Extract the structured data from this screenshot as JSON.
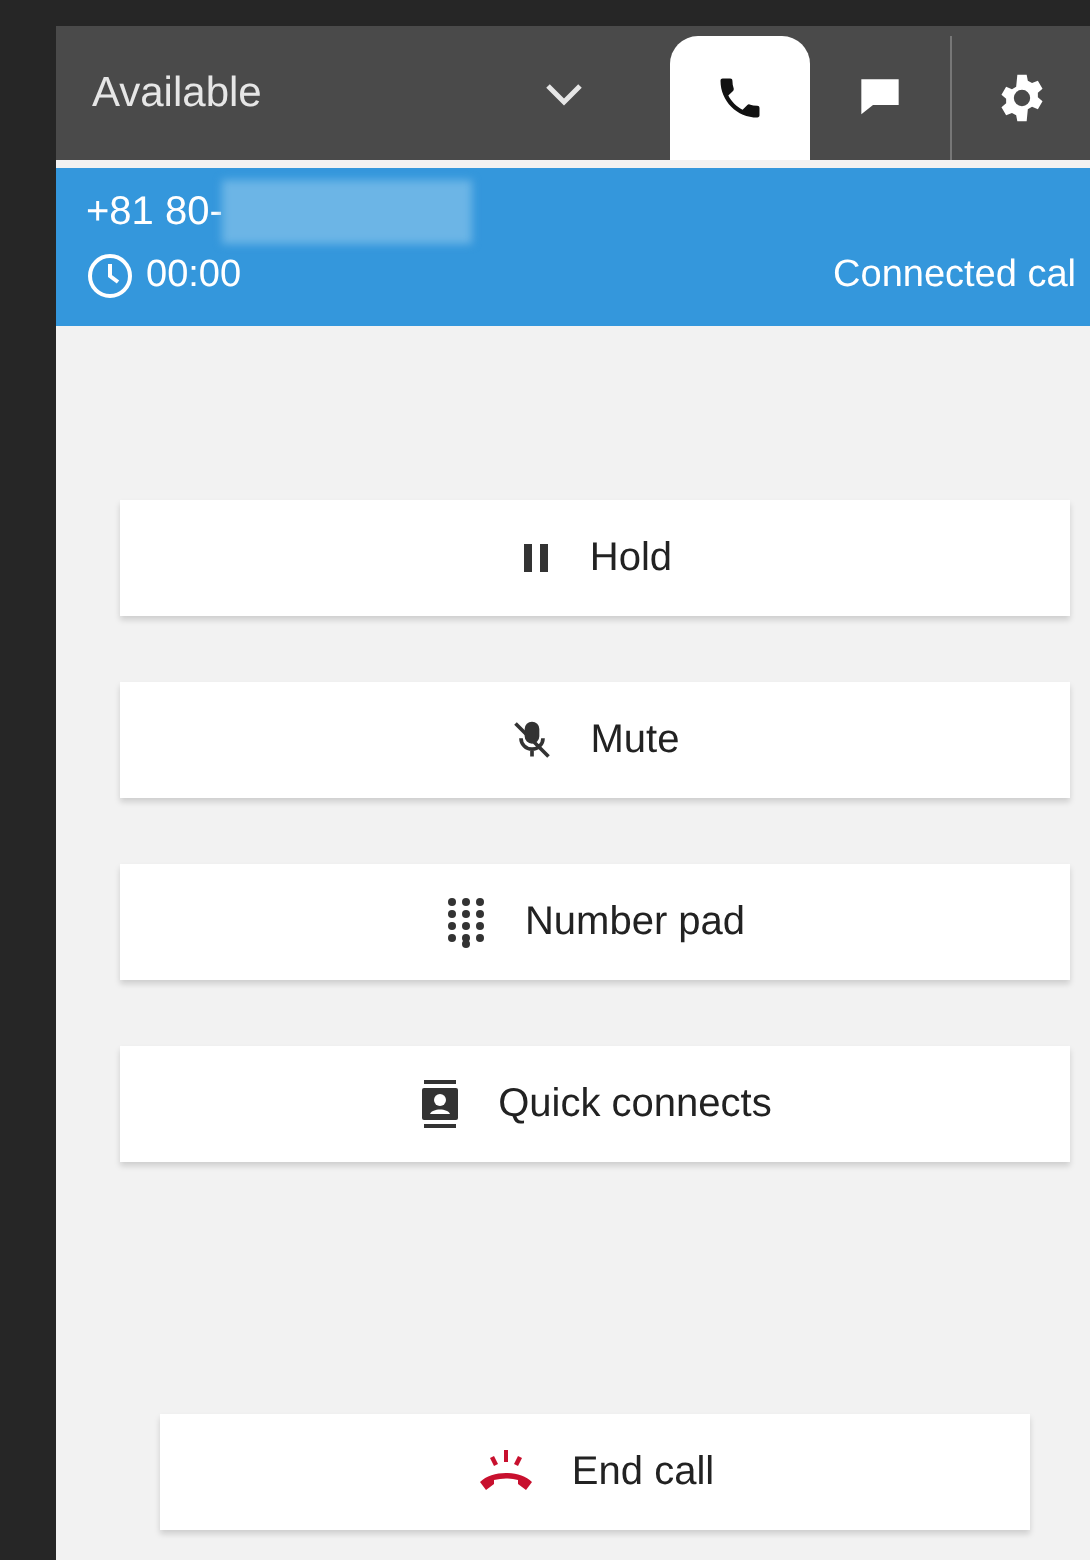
{
  "status_dropdown": {
    "value": "Available"
  },
  "tabs": [
    {
      "kind": "phone",
      "selected": true
    },
    {
      "kind": "chat",
      "selected": false
    },
    {
      "kind": "settings",
      "selected": false
    }
  ],
  "call_banner": {
    "phone_number": "+81 80-",
    "number_redacted": true,
    "timer": "00:00",
    "status": "Connected cal"
  },
  "actions": [
    {
      "kind": "hold",
      "label": "Hold"
    },
    {
      "kind": "mute",
      "label": "Mute"
    },
    {
      "kind": "number_pad",
      "label": "Number pad"
    },
    {
      "kind": "quick_connects",
      "label": "Quick connects"
    }
  ],
  "end_call": {
    "kind": "end_call",
    "label": "End call"
  }
}
